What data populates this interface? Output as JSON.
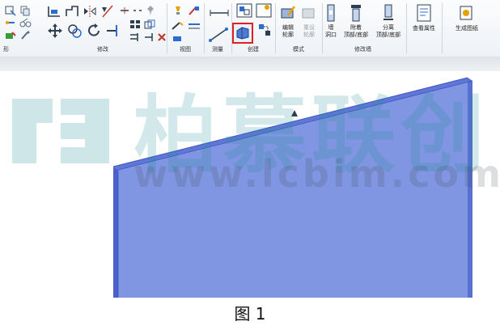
{
  "ribbon": {
    "panels": [
      {
        "label": "形"
      },
      {
        "label": "修改"
      },
      {
        "label": "视图"
      },
      {
        "label": "测量"
      },
      {
        "label": "创建"
      },
      {
        "label": "模式"
      },
      {
        "label": "修改墙"
      }
    ],
    "buttons": {
      "edit_profile": "编辑\n轮廓",
      "reset_profile": "重设\n轮廓",
      "wall_opening": "墙\n洞口",
      "attach_top_base": "附着\n顶部/底部",
      "detach_top_base": "分离\n顶部/底部",
      "view_properties": "查看属性",
      "generate_drawing": "生成图纸"
    },
    "highlight_color": "#e02020"
  },
  "watermark": {
    "brand": "柏慕联创",
    "url": "www.lcbim.com",
    "logo_color": "#1e8c96"
  },
  "scene": {
    "wall_color": "#7f94e0",
    "wall_edge_color": "#3e55c0"
  },
  "caption": "图 1"
}
